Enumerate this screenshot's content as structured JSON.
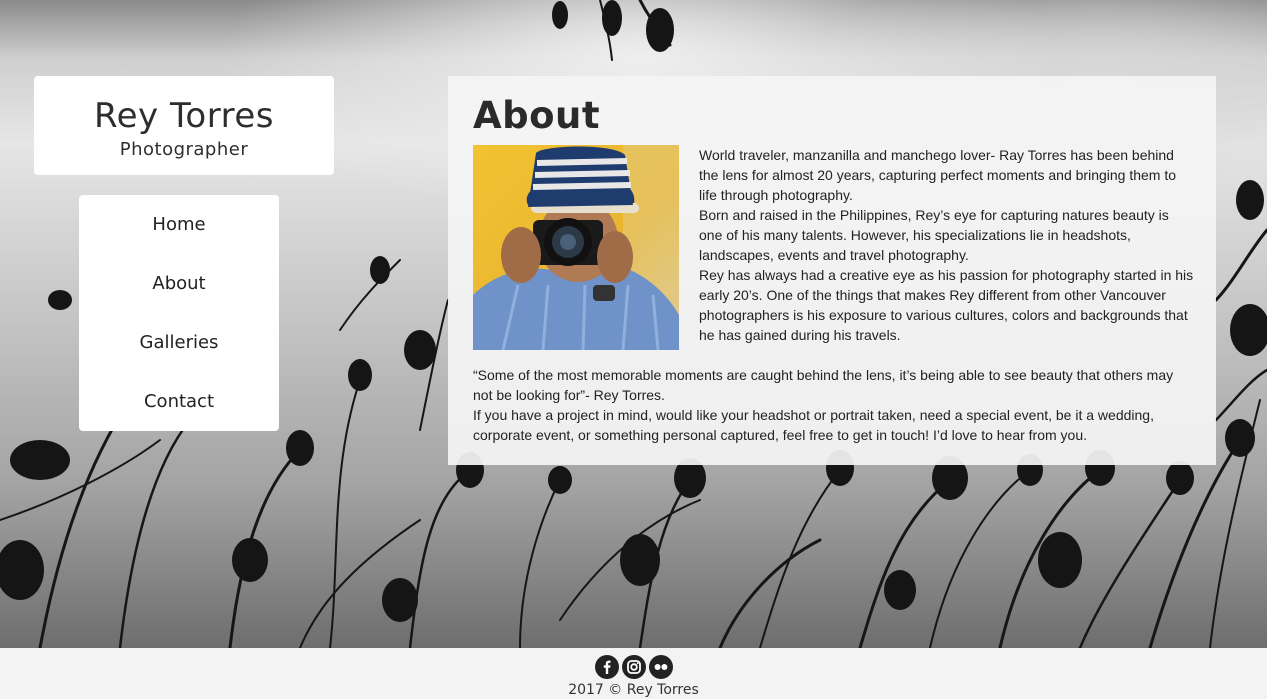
{
  "brand": {
    "name": "Rey Torres",
    "tagline": "Photographer"
  },
  "nav": {
    "items": [
      {
        "label": "Home"
      },
      {
        "label": "About"
      },
      {
        "label": "Galleries"
      },
      {
        "label": "Contact"
      }
    ]
  },
  "about": {
    "title": "About",
    "photo_icon": "photographer-portrait",
    "bio": [
      "World traveler, manzanilla and manchego lover- Ray Torres has been behind the lens for almost 20 years, capturing perfect moments and bringing them to life through photography.",
      "Born and raised in the Philippines, Rey’s eye for capturing natures beauty is one of his many talents. However, his specializations lie in headshots, landscapes, events and travel photography.",
      "Rey has always had a creative eye as his passion for photography started in his early 20’s. One of the things that makes Rey different from other Vancouver photographers is his exposure to various cultures, colors and backgrounds that he has gained during his travels."
    ],
    "quote": "“Some of the most memorable moments are caught behind the lens, it’s being able to see beauty that others may not be looking for”- Rey Torres.",
    "cta": "If you have a project in mind, would like your headshot or portrait taken, need a special event, be it a wedding, corporate event, or something personal captured, feel free to get in touch! I’d love to hear from you."
  },
  "footer": {
    "social": [
      {
        "icon": "facebook-icon"
      },
      {
        "icon": "instagram-icon"
      },
      {
        "icon": "flickr-icon"
      }
    ],
    "copyright": "2017 © Rey Torres"
  }
}
